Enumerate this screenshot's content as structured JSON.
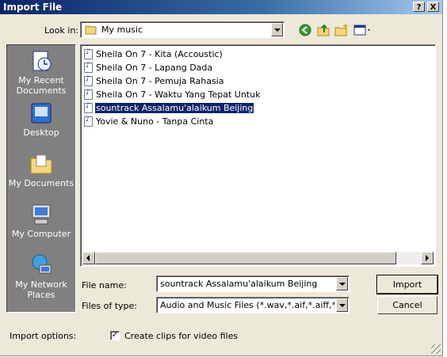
{
  "window": {
    "title": "Import File",
    "help_btn": "?",
    "close_btn": "X"
  },
  "lookin": {
    "label": "Look in:",
    "value": "My music"
  },
  "places": [
    {
      "label": "My Recent Documents",
      "icon": "recent-documents-icon"
    },
    {
      "label": "Desktop",
      "icon": "desktop-icon"
    },
    {
      "label": "My Documents",
      "icon": "my-documents-icon"
    },
    {
      "label": "My Computer",
      "icon": "my-computer-icon"
    },
    {
      "label": "My Network Places",
      "icon": "network-places-icon"
    }
  ],
  "files": [
    {
      "name": "Sheila On 7 - Kita (Accoustic)",
      "selected": false
    },
    {
      "name": "Sheila On 7 - Lapang Dada",
      "selected": false
    },
    {
      "name": "Sheila On 7 - Pemuja Rahasia",
      "selected": false
    },
    {
      "name": "Sheila On 7 - Waktu Yang Tepat Untuk",
      "selected": false
    },
    {
      "name": "sountrack Assalamu'alaikum Beijing",
      "selected": true
    },
    {
      "name": "Yovie & Nuno - Tanpa Cinta",
      "selected": false
    }
  ],
  "filename": {
    "label": "File name:",
    "value": "sountrack Assalamu'alaikum Beijing"
  },
  "filetype": {
    "label": "Files of type:",
    "value": "Audio and Music Files (*.wav,*.aif,*.aiff,*.aifc,*.s"
  },
  "buttons": {
    "import": "Import",
    "cancel": "Cancel"
  },
  "options": {
    "label": "Import options:",
    "checkbox_label": "Create clips for video files",
    "checked": true,
    "check_mark": "✓"
  },
  "colors": {
    "title_start": "#0a246a",
    "selection": "#0a246a",
    "places_bg": "#808080"
  }
}
